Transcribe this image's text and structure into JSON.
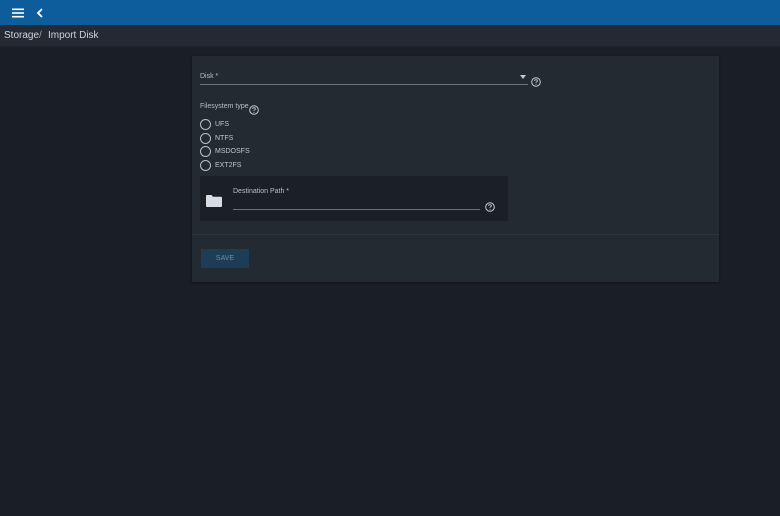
{
  "topbar": {
    "menu_icon": "hamburger-menu-icon",
    "back_icon": "chevron-left-icon",
    "bg_color": "#0d5d9c"
  },
  "breadcrumb": {
    "items": [
      {
        "label": "Storage"
      },
      {
        "label": "Import Disk"
      }
    ],
    "separator": "/"
  },
  "form": {
    "disk": {
      "label": "Disk *",
      "value": ""
    },
    "filesystem_type": {
      "label": "Filesystem type",
      "options": [
        "UFS",
        "NTFS",
        "MSDOSFS",
        "EXT2FS"
      ],
      "selected": null
    },
    "destination_path": {
      "label": "Destination Path *",
      "value": ""
    },
    "save_label": "SAVE"
  },
  "colors": {
    "accent": "#0d5d9c",
    "background": "#1a1f27",
    "card": "#232a32",
    "save_button": "#1d3d57"
  }
}
